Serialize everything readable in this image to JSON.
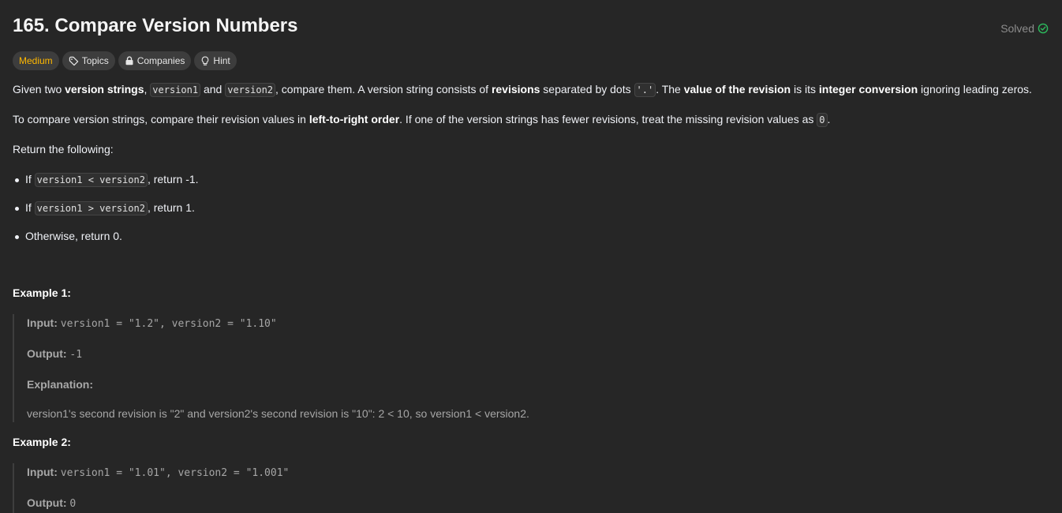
{
  "problem": {
    "title": "165. Compare Version Numbers",
    "status": "Solved",
    "tags": {
      "difficulty": "Medium",
      "topics": "Topics",
      "companies": "Companies",
      "hint": "Hint"
    }
  },
  "description": {
    "p1": {
      "t0": "Given two ",
      "b0": "version strings",
      "t1": ", ",
      "c0": "version1",
      "t2": " and ",
      "c1": "version2",
      "t3": ", compare them. A version string consists of ",
      "b1": "revisions",
      "t4": " separated by dots ",
      "c2": "'.'",
      "t5": ". The ",
      "b2": "value of the revision",
      "t6": " is its ",
      "b3": "integer conversion",
      "t7": " ignoring leading zeros."
    },
    "p2": {
      "t0": "To compare version strings, compare their revision values in ",
      "b0": "left-to-right order",
      "t1": ". If one of the version strings has fewer revisions, treat the missing revision values as ",
      "c0": "0",
      "t2": "."
    },
    "p3": "Return the following:",
    "bullets": [
      {
        "pre": "If ",
        "code": "version1 < version2",
        "post": ", return -1."
      },
      {
        "pre": "If ",
        "code": "version1 > version2",
        "post": ", return 1."
      },
      {
        "pre": "Otherwise, return 0.",
        "code": "",
        "post": ""
      }
    ]
  },
  "examples": [
    {
      "title": "Example 1:",
      "input_label": "Input:",
      "input": "version1 = \"1.2\", version2 = \"1.10\"",
      "output_label": "Output:",
      "output": "-1",
      "explanation_label": "Explanation:",
      "explanation": "version1's second revision is \"2\" and version2's second revision is \"10\": 2 < 10, so version1 < version2."
    },
    {
      "title": "Example 2:",
      "input_label": "Input:",
      "input": "version1 = \"1.01\", version2 = \"1.001\"",
      "output_label": "Output:",
      "output": "0"
    }
  ],
  "colors": {
    "background": "#262626",
    "difficulty_medium": "#ffb800",
    "solved_check": "#2cbb5d"
  },
  "icons": {
    "solved": "check-circle-icon",
    "topics": "tag-icon",
    "companies": "lock-icon",
    "hint": "lightbulb-icon"
  }
}
